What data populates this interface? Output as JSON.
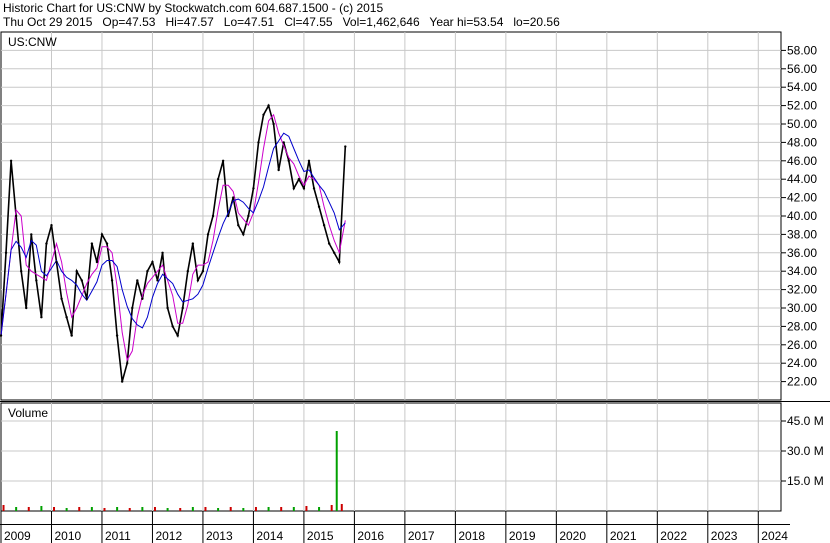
{
  "header": {
    "line1": "Historic Chart for US:CNW by Stockwatch.com 604.687.1500 - (c) 2015",
    "line2": "Thu Oct 29 2015   Op=47.53   Hi=47.57   Lo=47.51   Cl=47.55   Vol=1,462,646   Year hi=53.54   lo=20.56"
  },
  "colors": {
    "grid": "#c8c8c8",
    "price": "#000000",
    "ma_short": "#cc00cc",
    "ma_long": "#0000cc",
    "vol_up": "#00a000",
    "vol_down": "#cc0000",
    "frame": "#000000"
  },
  "chart_data": [
    {
      "type": "line",
      "title": "US:CNW",
      "y_tick_labels": [
        "22.00",
        "24.00",
        "26.00",
        "28.00",
        "30.00",
        "32.00",
        "34.00",
        "36.00",
        "38.00",
        "40.00",
        "42.00",
        "44.00",
        "46.00",
        "48.00",
        "50.00",
        "52.00",
        "54.00",
        "56.00",
        "58.00"
      ],
      "ylim": [
        20,
        60
      ],
      "x_tick_labels": [
        "2009",
        "2010",
        "2011",
        "2012",
        "2013",
        "2014",
        "2015",
        "2016",
        "2017",
        "2018",
        "2019",
        "2020",
        "2021",
        "2022",
        "2023",
        "2024"
      ],
      "xlim": [
        2009.0,
        2024.45
      ],
      "series": [
        {
          "role": "price",
          "x": [
            2009.0,
            2009.1,
            2009.2,
            2009.3,
            2009.4,
            2009.5,
            2009.6,
            2009.7,
            2009.8,
            2009.9,
            2010.0,
            2010.1,
            2010.2,
            2010.3,
            2010.4,
            2010.5,
            2010.6,
            2010.7,
            2010.8,
            2010.9,
            2011.0,
            2011.1,
            2011.2,
            2011.3,
            2011.4,
            2011.5,
            2011.6,
            2011.7,
            2011.8,
            2011.9,
            2012.0,
            2012.1,
            2012.2,
            2012.3,
            2012.4,
            2012.5,
            2012.6,
            2012.7,
            2012.8,
            2012.9,
            2013.0,
            2013.1,
            2013.2,
            2013.3,
            2013.4,
            2013.5,
            2013.6,
            2013.7,
            2013.8,
            2013.9,
            2014.0,
            2014.1,
            2014.2,
            2014.3,
            2014.4,
            2014.5,
            2014.6,
            2014.7,
            2014.8,
            2014.9,
            2015.0,
            2015.1,
            2015.2,
            2015.3,
            2015.4,
            2015.5,
            2015.6,
            2015.7,
            2015.82
          ],
          "y": [
            27,
            36,
            46,
            40,
            34,
            30,
            38,
            33,
            29,
            37,
            39,
            35,
            31,
            29,
            27,
            34,
            33,
            31,
            37,
            35,
            38,
            37,
            33,
            27,
            22,
            24,
            30,
            33,
            31,
            34,
            35,
            33,
            36,
            30,
            28,
            27,
            30,
            34,
            37,
            33,
            34,
            38,
            40,
            44,
            46,
            40,
            42,
            39,
            38,
            40,
            43,
            48,
            51,
            52,
            50,
            45,
            48,
            46,
            43,
            44,
            43,
            46,
            43,
            41,
            39,
            37,
            36,
            35,
            47.55
          ]
        },
        {
          "role": "ma_short",
          "x": [],
          "y": []
        },
        {
          "role": "ma_long",
          "x": [],
          "y": []
        }
      ]
    },
    {
      "type": "bar",
      "title": "Volume",
      "y_tick_labels": [
        "15.0 M",
        "30.0 M",
        "45.0 M"
      ],
      "ylim": [
        0,
        54
      ],
      "x": [
        2009.05,
        2009.3,
        2009.55,
        2009.8,
        2010.05,
        2010.3,
        2010.55,
        2010.8,
        2011.05,
        2011.3,
        2011.55,
        2011.8,
        2012.05,
        2012.3,
        2012.55,
        2012.8,
        2013.05,
        2013.3,
        2013.55,
        2013.8,
        2014.05,
        2014.3,
        2014.55,
        2014.8,
        2015.05,
        2015.3,
        2015.55,
        2015.65,
        2015.75
      ],
      "values": [
        3,
        2,
        2,
        2.5,
        2,
        1.5,
        2,
        2,
        1.5,
        2,
        1.5,
        2,
        2,
        1.5,
        1.5,
        2,
        2,
        1.5,
        2,
        1.5,
        2,
        2,
        2,
        2,
        2.5,
        2,
        3,
        40,
        3.5
      ],
      "units": "M"
    }
  ]
}
